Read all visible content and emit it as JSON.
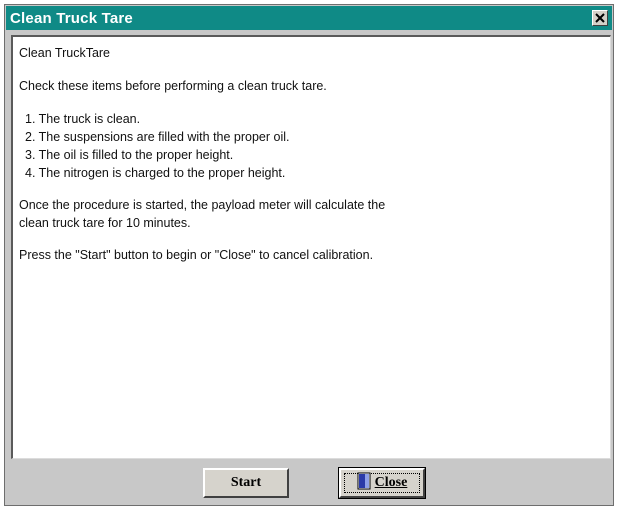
{
  "window": {
    "title": "Clean Truck Tare"
  },
  "content": {
    "heading": "Clean TruckTare",
    "intro": "Check these items before performing a clean truck tare.",
    "checklist": [
      "1. The truck is clean.",
      "2. The suspensions are filled with the proper oil.",
      "3. The oil is filled to the proper height.",
      "4. The nitrogen is charged to the proper height."
    ],
    "note_line1": "Once the procedure is started, the payload meter will calculate the",
    "note_line2": "clean truck tare for 10 minutes.",
    "instruction": "Press the \"Start\" button to begin or \"Close\" to cancel calibration."
  },
  "buttons": {
    "start_label": "Start",
    "close_label": "Close",
    "close_icon": "door-icon"
  },
  "colors": {
    "titlebar": "#0f8a86",
    "window_bg": "#c8c8c8"
  }
}
